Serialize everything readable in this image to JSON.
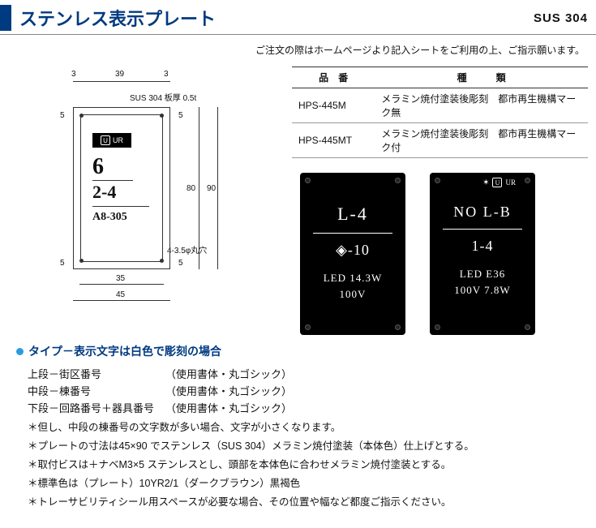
{
  "header": {
    "title": "ステンレス表示プレート",
    "material": "SUS 304"
  },
  "orderNote": "ご注文の際はホームページより記入シートをご利用の上、ご指示願います。",
  "diagram": {
    "materialNote": "SUS 304 板厚 0.5t",
    "holeNote": "4-3.5φ丸穴",
    "dims": {
      "d3a": "3",
      "d39": "39",
      "d3b": "3",
      "d5a": "5",
      "d5b": "5",
      "d5c": "5",
      "d5d": "5",
      "d80": "80",
      "d90": "90",
      "d35": "35",
      "d45": "45"
    },
    "band": {
      "mark": "U",
      "text": "UR"
    },
    "lines": {
      "top": "6",
      "mid": "2-4",
      "bottom": "A8-305"
    }
  },
  "table": {
    "headers": {
      "code": "品　番",
      "type": "種　　　類"
    },
    "rows": [
      {
        "code": "HPS-445M",
        "type": "メラミン焼付塗装後彫刻　都市再生機構マーク無"
      },
      {
        "code": "HPS-445MT",
        "type": "メラミン焼付塗装後彫刻　都市再生機構マーク付"
      }
    ]
  },
  "samples": {
    "left": {
      "row1": "L-4",
      "row2": "◈-10",
      "row3": "LED 14.3W",
      "row4": "100V"
    },
    "right": {
      "urText": "UR",
      "row1": "NO L-B",
      "row2": "1-4",
      "row3": "LED E36",
      "row4": "100V 7.8W"
    }
  },
  "typeSection": {
    "heading": "タイプ－表示文字は白色で彫刻の場合",
    "rows": [
      {
        "label": "上段－街区番号",
        "value": "（使用書体・丸ゴシック）"
      },
      {
        "label": "中段－棟番号",
        "value": "（使用書体・丸ゴシック）"
      },
      {
        "label": "下段－回路番号＋器具番号",
        "value": "（使用書体・丸ゴシック）"
      }
    ],
    "notes": [
      "＊但し、中段の棟番号の文字数が多い場合、文字が小さくなります。",
      "＊プレートの寸法は45×90 でステンレス（SUS 304）メラミン焼付塗装（本体色）仕上げとする。",
      "＊取付ビスは＋ナベM3×5 ステンレスとし、頭部を本体色に合わせメラミン焼付塗装とする。",
      "＊標準色は（プレート）10YR2/1（ダークブラウン）黒褐色",
      "＊トレーサビリティシール用スペースが必要な場合、その位置や幅など都度ご指示ください。"
    ]
  }
}
